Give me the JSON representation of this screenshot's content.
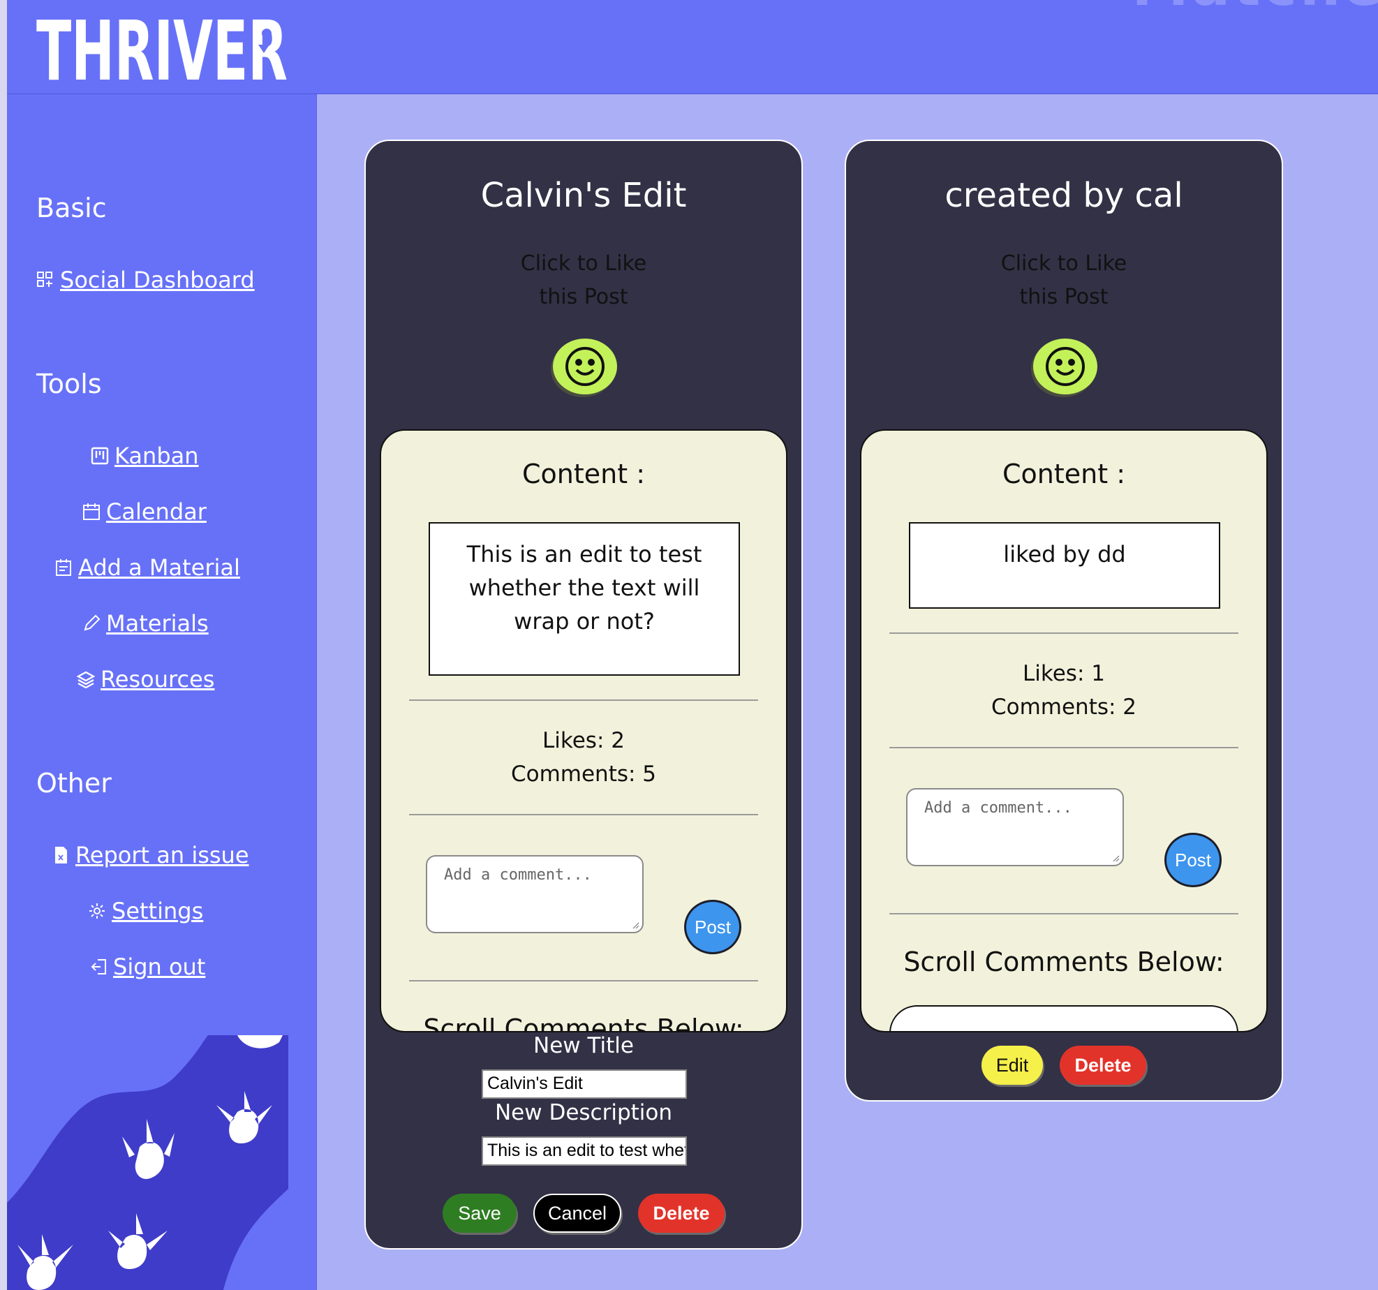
{
  "app": {
    "logo_text": "THRIVER",
    "top_right_faded": "Matche"
  },
  "colors": {
    "header": "#6771f7",
    "sidebar": "#6771f7",
    "main_bg": "#abb0f6",
    "card": "#333146",
    "inner_card": "#f2f2dc",
    "like_button": "#c2f15a",
    "post_button": "#3d95ee",
    "save": "#2f7d22",
    "cancel": "#000000",
    "delete": "#e2332a",
    "edit": "#f6f04a"
  },
  "sidebar": {
    "sections": [
      {
        "title": "Basic",
        "items": [
          {
            "label": "Social Dashboard",
            "icon": "dashboard-icon"
          }
        ]
      },
      {
        "title": "Tools",
        "items": [
          {
            "label": "Kanban",
            "icon": "kanban-icon"
          },
          {
            "label": "Calendar",
            "icon": "calendar-icon"
          },
          {
            "label": "Add a Material",
            "icon": "add-material-icon"
          },
          {
            "label": "Materials",
            "icon": "pencil-icon"
          },
          {
            "label": "Resources",
            "icon": "layers-icon"
          }
        ]
      },
      {
        "title": "Other",
        "items": [
          {
            "label": "Report an issue",
            "icon": "report-file-icon"
          },
          {
            "label": "Settings",
            "icon": "gear-icon"
          },
          {
            "label": "Sign out",
            "icon": "sign-out-icon"
          }
        ]
      }
    ]
  },
  "posts": [
    {
      "title": "Calvin's Edit",
      "like_prompt": [
        "Click to Like",
        "this Post"
      ],
      "content_label": "Content :",
      "content_lines": [
        "This is an edit to test",
        "whether the text will",
        "wrap or not?"
      ],
      "likes": "Likes: 2",
      "comments": "Comments: 5",
      "comment_placeholder": "Add a comment...",
      "post_label": "Post",
      "scroll_label": "Scroll Comments Below:",
      "edit_mode": {
        "new_title_label": "New Title",
        "new_title_value": "Calvin's Edit",
        "new_description_label": "New Description",
        "new_description_value": "This is an edit to test whether the text will wrap or not?",
        "save_label": "Save",
        "cancel_label": "Cancel",
        "delete_label": "Delete"
      }
    },
    {
      "title": "created by cal",
      "like_prompt": [
        "Click to Like",
        "this Post"
      ],
      "content_label": "Content :",
      "content_lines": [
        "liked by dd"
      ],
      "likes": "Likes: 1",
      "comments": "Comments: 2",
      "comment_placeholder": "Add a comment...",
      "post_label": "Post",
      "scroll_label": "Scroll Comments Below:",
      "edit_label": "Edit",
      "delete_label": "Delete"
    }
  ]
}
